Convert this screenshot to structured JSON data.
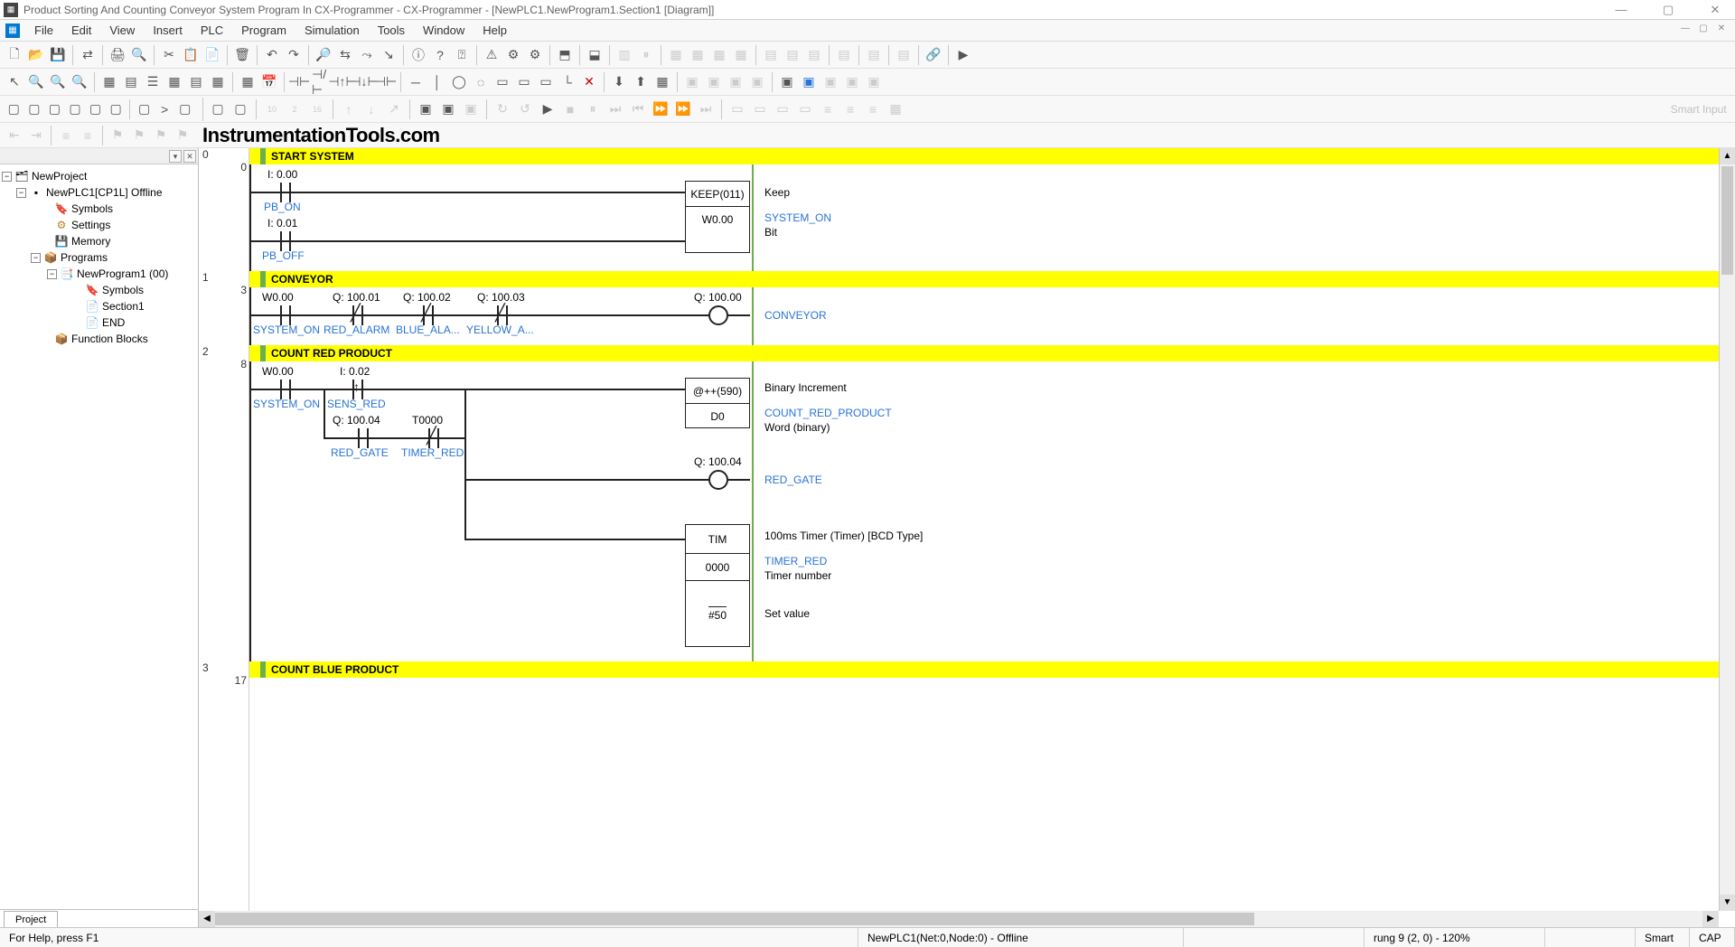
{
  "title": "Product Sorting And Counting Conveyor System Program In CX-Programmer - CX-Programmer - [NewPLC1.NewProgram1.Section1 [Diagram]]",
  "menus": [
    "File",
    "Edit",
    "View",
    "Insert",
    "PLC",
    "Program",
    "Simulation",
    "Tools",
    "Window",
    "Help"
  ],
  "watermark": "InstrumentationTools.com",
  "tree": {
    "root": "NewProject",
    "plc": "NewPLC1[CP1L] Offline",
    "symbols": "Symbols",
    "settings": "Settings",
    "memory": "Memory",
    "programs": "Programs",
    "newprogram": "NewProgram1 (00)",
    "psymbols": "Symbols",
    "section1": "Section1",
    "end": "END",
    "fb": "Function Blocks"
  },
  "proj_tab": "Project",
  "gutter": {
    "r0": "0",
    "r0s": "0",
    "r1": "1",
    "r1s": "3",
    "r2": "2",
    "r2s": "8",
    "r3": "3",
    "r3s": "17"
  },
  "rung0": {
    "title": "START SYSTEM",
    "i000": "I: 0.00",
    "pb_on": "PB_ON",
    "i001": "I: 0.01",
    "pb_off": "PB_OFF",
    "keep": "KEEP(011)",
    "w000": "W0.00",
    "d_keep": "Keep",
    "sys_on": "SYSTEM_ON",
    "d_bit": "Bit"
  },
  "rung1": {
    "title": "CONVEYOR",
    "w000": "W0.00",
    "sys_on": "SYSTEM_ON",
    "q1": "Q: 100.01",
    "red_alarm": "RED_ALARM",
    "q2": "Q: 100.02",
    "blue_ala": "BLUE_ALA...",
    "q3": "Q: 100.03",
    "yellow_a": "YELLOW_A...",
    "q0": "Q: 100.00",
    "conveyor": "CONVEYOR"
  },
  "rung2": {
    "title": "COUNT RED PRODUCT",
    "w000": "W0.00",
    "sys_on": "SYSTEM_ON",
    "i002": "I: 0.02",
    "sens_red": "SENS_RED",
    "q4": "Q: 100.04",
    "red_gate": "RED_GATE",
    "t0000": "T0000",
    "timer_red": "TIMER_RED",
    "inc": "@++(590)",
    "d0": "D0",
    "d_inc": "Binary Increment",
    "count_red": "COUNT_RED_PRODUCT",
    "d_word": "Word (binary)",
    "q4b": "Q: 100.04",
    "red_gate_b": "RED_GATE",
    "tim": "TIM",
    "t0000b": "0000",
    "tval": "#50",
    "d_tim": "100ms Timer (Timer) [BCD Type]",
    "timer_red_b": "TIMER_RED",
    "d_tn": "Timer number",
    "d_sv": "Set value"
  },
  "rung3": {
    "title": "COUNT BLUE PRODUCT"
  },
  "status": {
    "help": "For Help, press F1",
    "plc": "NewPLC1(Net:0,Node:0) - Offline",
    "rung": "rung 9 (2, 0)  - 120%",
    "smart": "Smart",
    "cap": "CAP"
  }
}
